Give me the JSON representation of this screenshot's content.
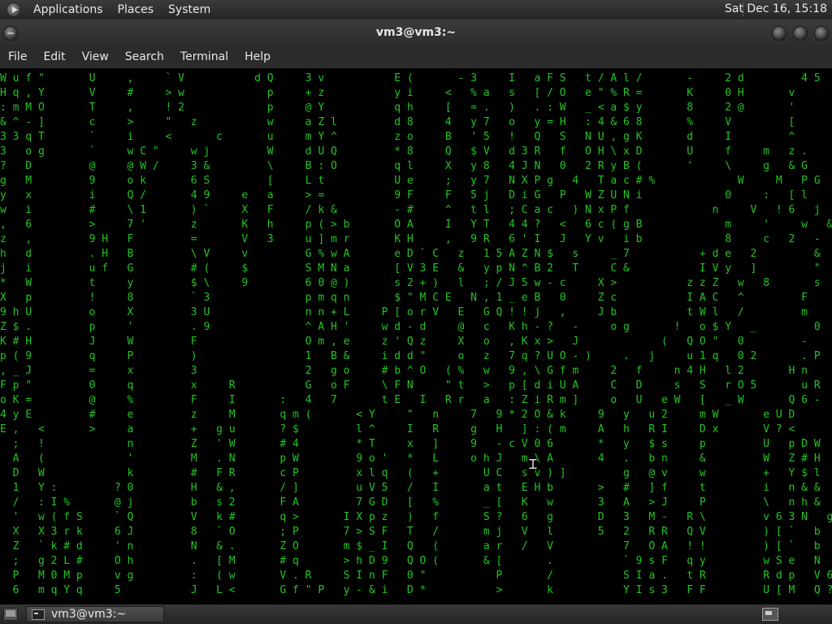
{
  "top_panel": {
    "menus": [
      "Applications",
      "Places",
      "System"
    ],
    "clock": "Sat Dec 16, 15:18"
  },
  "window": {
    "title": "vm3@vm3:~",
    "menus": [
      "File",
      "Edit",
      "View",
      "Search",
      "Terminal",
      "Help"
    ]
  },
  "terminal": {
    "colors": {
      "text": "#23c423",
      "highlight": "#ffffff",
      "background": "#000000"
    },
    "lines": [
      "W u f \"       U     ,     ` V           d Q     3 v           E (       - 3     I   a F S   t / A l /       -     2 d         4 5",
      "H q , Y       V     #     > w             p     + z           y i     <   % a   s   [ / O   e \" % R =       K     0 H       v",
      ": m M O       T     ,     ! 2             p     @ Y           q h     [   = .   )   . : W   _ < a $ y       8     2 @       '       S",
      "& ^ - ]       c     >     \"   z           w     a Z l         d 8     4   y 7   o   y = H   : 4 & 6 8       %     V         [       0",
      "3 3 q T       `     i     <       c       u     m Y ^         z o     B   ' 5   !   Q   S   N U , g K       d     I         ^       :",
      "3   o g       `     w C \"     w j         W     d U Q         * 8     Q   $ V   d 3 R   f   O H \\ x D       U     f     m   z .     2",
      "?   D         @     @ W /     3 &         \\     B : O         q l     X   y 8   4 J N   0   2 R y B (       '     \\     g   & G     r",
      "g   M         9     o k       6 S         [     L t           U e     ;   y 7   N X P g   4   T a c # %             W     M   P G     [",
      "y   x         i     Q /       4 9     e   a     > =           9 F     F   5 j   D i G   P   W Z U N i             0     :   [ l     j",
      "w   i         #     \\ 1       ) `     X   F     / k &         - #     ^   t l   ; C a c   ) N x P f             n     V   ! 6   j",
      ",   6         >     7 '       z       K   h     p ( > b       O A     I   Y T   4 4 ?   <   6 c ( g B             m     '     w   &",
      "z   ,         9 H   F         =       V   3     u ] m r       K H     ,   9 R   6 ' I   J   Y v   i b             8     c   2   -   (",
      "h   d         . H   B         \\ V     v         G % w A       e D ` C   z   1 5 A Z N $   s     _ 7           + d e   2         &",
      "j   i         u f   G         # (     $         S M N a       [ V 3 E   &   y p N ^ B 2   T     C &           I V y   ]         \"",
      "*   W         t     y         $ \\     9         6 0 @ )       s 2 + )   l   ; / J 5 w - c     X >           z z Z   w   8       s",
      "X   p         !     8         ` 3               p m q n       $ \" M C E   N , 1 _ e B   0     Z c           I A C   ^         F",
      "9 h U         o     X         3 U               n n + L     P [ o r V   E   G Q ! ! j   ,     J b           t W l   /         m",
      "Z $ .         p     '         . 9               ^ A H '     w d - d     @   c   K h - ?   -     o g       !   o $ Y   _         0",
      "K # H         J     W         F                 O m , e     z ' Q z     X   o   , K x >   J             (   Q O \"   0         -",
      "p ( 9         q     P         )                 1   B &     i d d \"     o   z   7 q ? U O - )     .   j     u 1 q   0 2       . P",
      ", _ J         =     x         3                 2   g o     # b ^ O   ( %   w   9 , \\ G f m     2   f     n 4 H   l 2       H n",
      "F p \"         0     q         x     R           G   o F     \\ F N     \" t   >   p [ d i U A     C   D     s   S   r O 5       u R",
      "o K =         @     %         F     I       :   4   7       t E   I   R r   a   : Z i R m ]     o   U   e W   [   _ W       Q 6 -",
      "4 y E         #     e         z     M       q m (       < Y     \"   n     7   9 * 2 O & k     9   y   u 2     m W       e U D",
      "E ,   <       >     a         +   g u       ? $         l ^     I   R     g   H   ] : ( m     A   h   R I     D x       V ? <",
      "  ;   !             n         Z   ' W       # 4         * T     x   ]     9   - c V 0 6       *   y   $ s     p         U   p D W",
      "  A   (             '         M   . N       p W         9 o '   *   L     o h J   m \\ A       4   .   b n     &         W   Z # H",
      "  D   W             k         #   F R       c P         x l q   (   +       U C   s v ) ]         g   @ v     w         +   Y $ l",
      "  1   Y :         ? 0         H   & ,       / ]         u V 5   /   I       a t   E H b       >   #   ] f     t         i   n & &",
      "  /   : I %       @ j         b   s 2       F A         7 G D   [   %       _ [   K   w       3   A   > J     P         \\   n h &",
      "  '   w ( f S     ` Q         V   k #       q >       I X p z   )   f       S ?   6   g       D   3   M -   R \\         v 6 3 N   g",
      "  X   X 3 r k     6 J         8   ` O       ; P       7 > S F   T   /       m j   V   l       5   2   R R   Q V         ) [ `   b",
      "  Z   ` k # d     ' n         N   & .       Z O       m $ _ I   Q   (       a r   /   V           7   O A   ! !         ) [ `   b",
      "  ;   g 2 L #     O h         .   [ M       # q       > h D 9   Q O (       & [       .           ` 9 s F   q y         w S e   N",
      "  P   M 0 M p     v g         :   ( w       V . R     S I n F   0 \"           P       /           S I a .   t R         R d p   V 6",
      "  6   m q Y q     5           J   L <       G f \" P   y - & i   D *           >       k           Y I s 3   F F         U [ M   Q ?"
    ]
  },
  "taskbar": {
    "window_label": "vm3@vm3:~"
  }
}
